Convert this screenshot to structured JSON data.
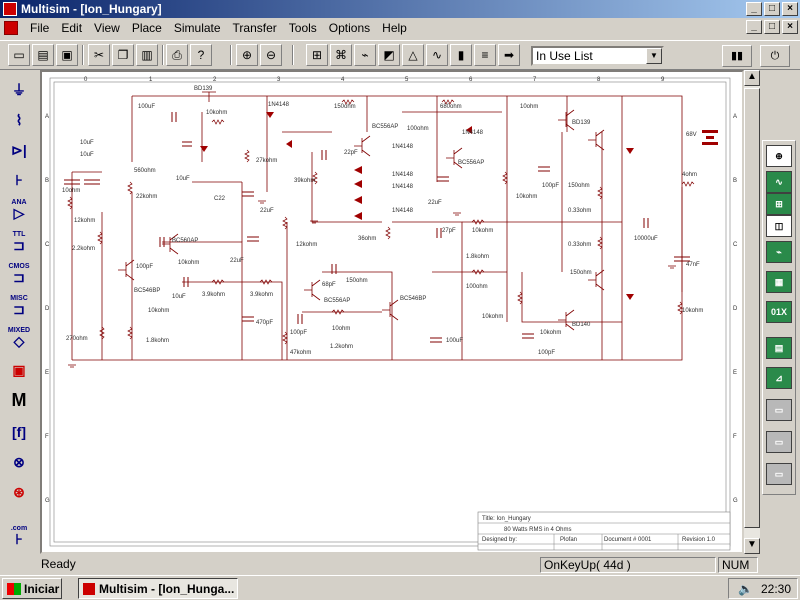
{
  "window": {
    "title": "Multisim - [Ion_Hungary]",
    "controls": [
      "_",
      "□",
      "×"
    ]
  },
  "menu": [
    "File",
    "Edit",
    "View",
    "Place",
    "Simulate",
    "Transfer",
    "Tools",
    "Options",
    "Help"
  ],
  "toolbar": {
    "combo_value": "In Use List"
  },
  "left_palette": [
    "TTL",
    "CMOS",
    "MISC",
    "MIXED",
    "ANA",
    ".com"
  ],
  "schematic": {
    "column_ticks": [
      "0",
      "1",
      "2",
      "3",
      "4",
      "5",
      "6",
      "7",
      "8",
      "9"
    ],
    "row_ticks": [
      "A",
      "B",
      "C",
      "D",
      "E",
      "F",
      "G"
    ],
    "labels": [
      "BD139",
      "1N4148",
      "150ohm",
      "680ohm",
      "10ohm",
      "BD139",
      "100uF",
      "10kohm",
      "BC556AP",
      "100ohm",
      "1N4148",
      "10uF",
      "10uF",
      "560ohm",
      "27kohm",
      "22pF",
      "BC556AP",
      "68V",
      "10uF",
      "1N4148",
      "1N4148",
      "100pF",
      "150ohm",
      "22kohm",
      "C22",
      "39kohm",
      "1N4148",
      "22uF",
      "10kohm",
      "4ohm",
      "12kohm",
      "22uF",
      "1N4148",
      "0.33ohm",
      "2.2kohm",
      "BC560AP",
      "12kohm",
      "36ohm",
      "27pF",
      "10kohm",
      "10000uF",
      "0.33ohm",
      "100pF",
      "10kohm",
      "22uF",
      "1.8kohm",
      "47nF",
      "BC546BP",
      "10uF",
      "3.9kohm",
      "3.9kohm",
      "68pF",
      "150ohm",
      "BC546BP",
      "100ohm",
      "150ohm",
      "10kohm",
      "BC556AP",
      "10kohm",
      "270ohm",
      "1.8kohm",
      "470pF",
      "100pF",
      "10ohm",
      "10kohm",
      "10kohm",
      "BD140",
      "47kohm",
      "1.2kohm",
      "100uF",
      "100pF",
      "10ohm"
    ]
  },
  "title_block": {
    "title": "Title:  Ion_Hungary",
    "desc": "80 Watts RMS in 4 Ohms",
    "designed_by": "Designed by:",
    "designer": "Plofan",
    "document": "Document #  0001",
    "revision": "Revision  1.0"
  },
  "status": {
    "left": "Ready",
    "mid": "OnKeyUp( 44d )",
    "num": "NUM"
  },
  "taskbar": {
    "start": "Iniciar",
    "task": "Multisim - [Ion_Hunga...",
    "clock": "22:30"
  }
}
